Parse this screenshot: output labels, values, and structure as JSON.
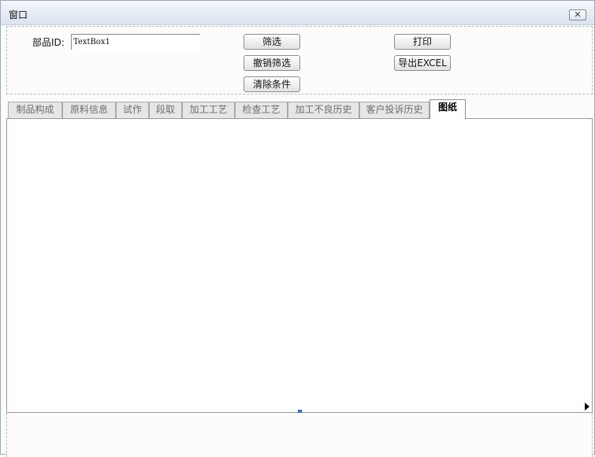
{
  "window": {
    "title": "窗口",
    "close_symbol": "✕"
  },
  "filter": {
    "part_id_label": "部品ID:",
    "part_id_value": "TextBox1",
    "buttons": {
      "filter": "筛选",
      "cancel_filter": "撤销筛选",
      "clear_conditions": "清除条件",
      "print": "打印",
      "export_excel": "导出EXCEL"
    }
  },
  "tabs": [
    {
      "label": "制品构成",
      "active": false
    },
    {
      "label": "原料信息",
      "active": false
    },
    {
      "label": "试作",
      "active": false
    },
    {
      "label": "段取",
      "active": false
    },
    {
      "label": "加工工艺",
      "active": false
    },
    {
      "label": "检查工艺",
      "active": false
    },
    {
      "label": "加工不良历史",
      "active": false
    },
    {
      "label": "客户投诉历史",
      "active": false
    },
    {
      "label": "图纸",
      "active": true
    }
  ],
  "colors": {
    "active_tab_bg": "#ffffff",
    "inactive_tab_bg": "#e6e6e6",
    "selection_handle": "#3f7fd9"
  },
  "icons": {
    "close": "close-icon",
    "scroll_right": "triangle-right-icon"
  }
}
